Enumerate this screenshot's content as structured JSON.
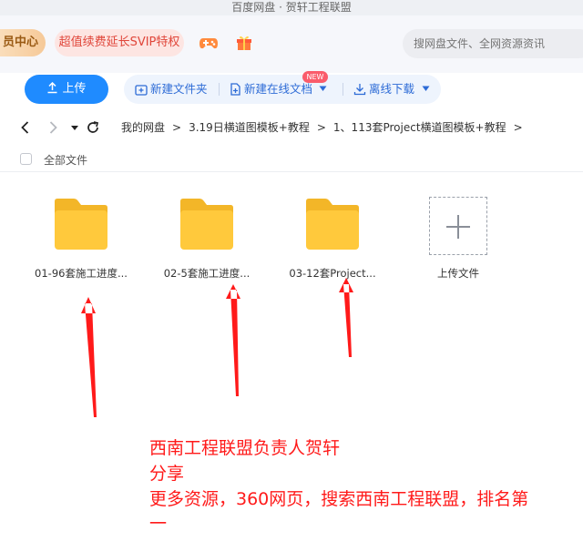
{
  "window": {
    "title": "百度网盘 · 贺轩工程联盟"
  },
  "topbar": {
    "vip_center": "员中心",
    "svip_promo": "超值续费延长SVIP特权",
    "game_icon": "game-controller-icon",
    "gift_icon": "gift-icon",
    "search_placeholder": "搜网盘文件、全网资源资讯"
  },
  "toolbar": {
    "upload": "上传",
    "new_folder": "新建文件夹",
    "new_online_doc": "新建在线文档",
    "new_badge": "NEW",
    "offline_download": "离线下载"
  },
  "breadcrumb": {
    "items": [
      "我的网盘",
      "3.19日横道图模板+教程",
      "1、113套Project横道图模板+教程"
    ]
  },
  "list": {
    "all_files": "全部文件",
    "files": [
      {
        "name": "01-96套施工进度..."
      },
      {
        "name": "02-5套施工进度..."
      },
      {
        "name": "03-12套Project..."
      }
    ],
    "upload_file": "上传文件"
  },
  "annotation": {
    "line1": "西南工程联盟负责人贺轩",
    "line2": "分享",
    "line3": "更多资源，360网页，搜索西南工程联盟，排名第",
    "line4": "一"
  },
  "colors": {
    "accent": "#1f8bff",
    "folder": "#ffc93c",
    "annotation": "#ff1a1a"
  }
}
